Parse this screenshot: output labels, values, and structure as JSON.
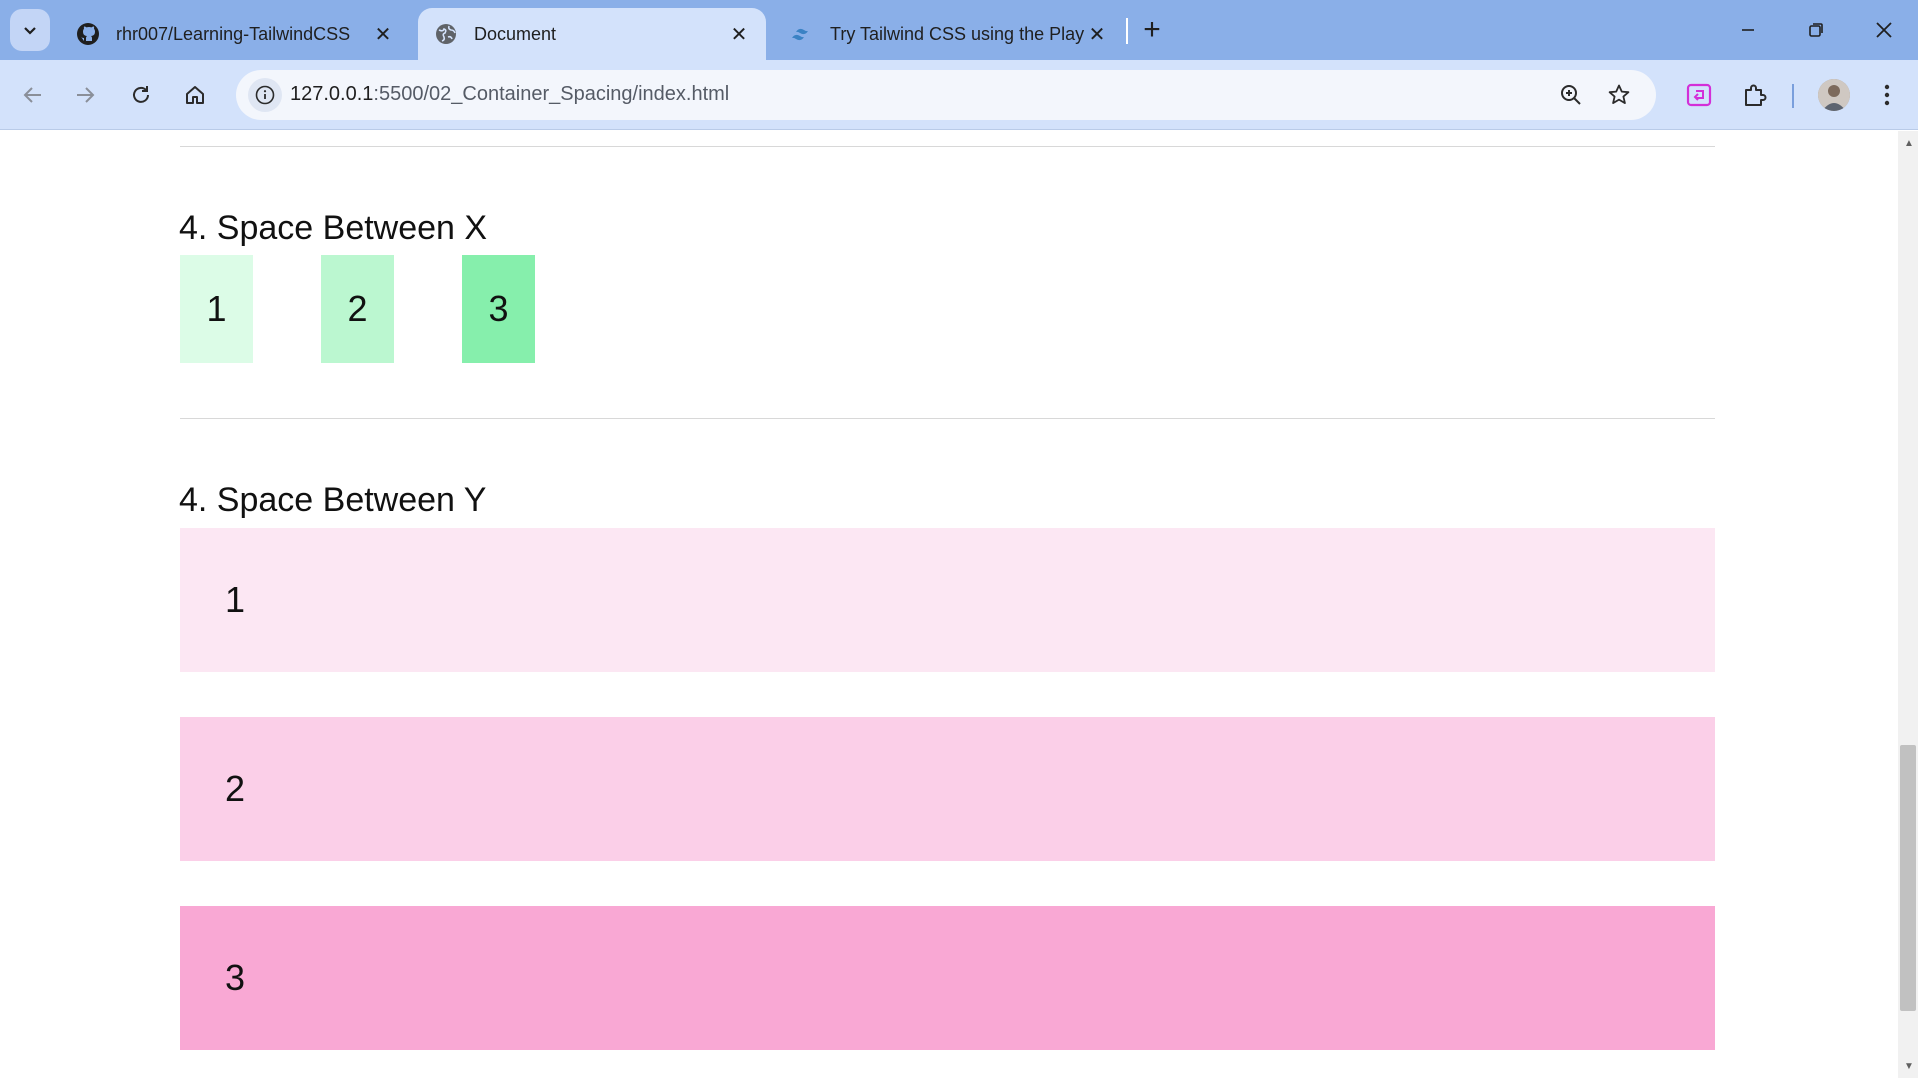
{
  "browser": {
    "tabs": [
      {
        "title": "rhr007/Learning-TailwindCSS",
        "icon": "github-icon"
      },
      {
        "title": "Document",
        "icon": "globe-icon"
      },
      {
        "title": "Try Tailwind CSS using the Play",
        "icon": "tailwind-icon"
      }
    ],
    "url_host": "127.0.0.1",
    "url_path": ":5500/02_Container_Spacing/index.html"
  },
  "page": {
    "space_x": {
      "title": "4. Space Between X",
      "boxes": [
        {
          "label": "1",
          "color": "#dcfce7"
        },
        {
          "label": "2",
          "color": "#bbf7d0"
        },
        {
          "label": "3",
          "color": "#86efac"
        }
      ]
    },
    "space_y": {
      "title": "4. Space Between Y",
      "boxes": [
        {
          "label": "1",
          "color": "#fce7f3"
        },
        {
          "label": "2",
          "color": "#fbcfe8"
        },
        {
          "label": "3",
          "color": "#f9a8d4"
        }
      ]
    }
  }
}
